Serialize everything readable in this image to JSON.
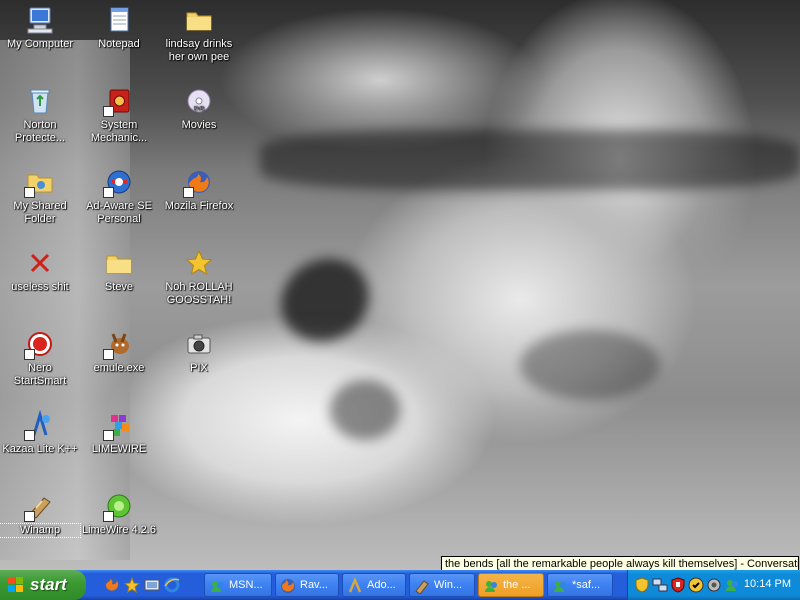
{
  "desktop": {
    "icons": [
      {
        "label": "My Computer",
        "icon": "my-computer-icon"
      },
      {
        "label": "Notepad",
        "icon": "notepad-icon"
      },
      {
        "label": "lindsay drinks her own pee",
        "icon": "folder-icon"
      },
      {
        "label": "Norton Protecte...",
        "icon": "recycle-bin-icon"
      },
      {
        "label": "System Mechanic...",
        "icon": "system-mechanic-icon"
      },
      {
        "label": "Movies",
        "icon": "dvd-icon"
      },
      {
        "label": "My Shared Folder",
        "icon": "shared-folder-icon"
      },
      {
        "label": "Ad-Aware SE Personal",
        "icon": "ad-aware-icon"
      },
      {
        "label": "Mozila Firefox",
        "icon": "firefox-icon"
      },
      {
        "label": "useless shit",
        "icon": "red-x-icon"
      },
      {
        "label": "Steve",
        "icon": "folder-icon"
      },
      {
        "label": "Noh ROLLAH GOOSSTAH!",
        "icon": "star-icon"
      },
      {
        "label": "Nero StartSmart",
        "icon": "nero-icon"
      },
      {
        "label": "emule.exe",
        "icon": "emule-icon"
      },
      {
        "label": "PIX",
        "icon": "camera-icon"
      },
      {
        "label": "Kazaa Lite K++",
        "icon": "kazaa-icon"
      },
      {
        "label": "LIMEWIRE",
        "icon": "limewire-blocks-icon"
      },
      {
        "label": "Winamp",
        "icon": "winamp-icon"
      },
      {
        "label": "LimeWire 4.2.6",
        "icon": "limewire-icon"
      }
    ]
  },
  "tooltip": {
    "text": "the bends [all the remarkable people always kill themselves] - Conversation"
  },
  "taskbar": {
    "start_label": "start",
    "quick_launch": [
      "firefox-icon",
      "star-icon",
      "desktop-icon",
      "ie-icon"
    ],
    "tasks": [
      {
        "label": "MSN...",
        "icon": "msn-icon",
        "active": false
      },
      {
        "label": "Rav...",
        "icon": "firefox-icon",
        "active": false
      },
      {
        "label": "Ado...",
        "icon": "adobe-icon",
        "active": false
      },
      {
        "label": "Win...",
        "icon": "winamp-icon",
        "active": false
      },
      {
        "label": "the ...",
        "icon": "msn-conversation-icon",
        "active": true
      },
      {
        "label": "*saf...",
        "icon": "msn-conversation-icon",
        "active": false
      }
    ],
    "tray_icons": [
      "shield-icon",
      "network-icon",
      "security-icon",
      "norton-icon",
      "settings-icon",
      "msn-tray-icon"
    ],
    "clock": "10:14 PM"
  },
  "colors": {
    "taskbar": "#245edb",
    "start": "#3c9a33",
    "tray": "#0f8ad8",
    "active_task": "#ef9f25"
  }
}
